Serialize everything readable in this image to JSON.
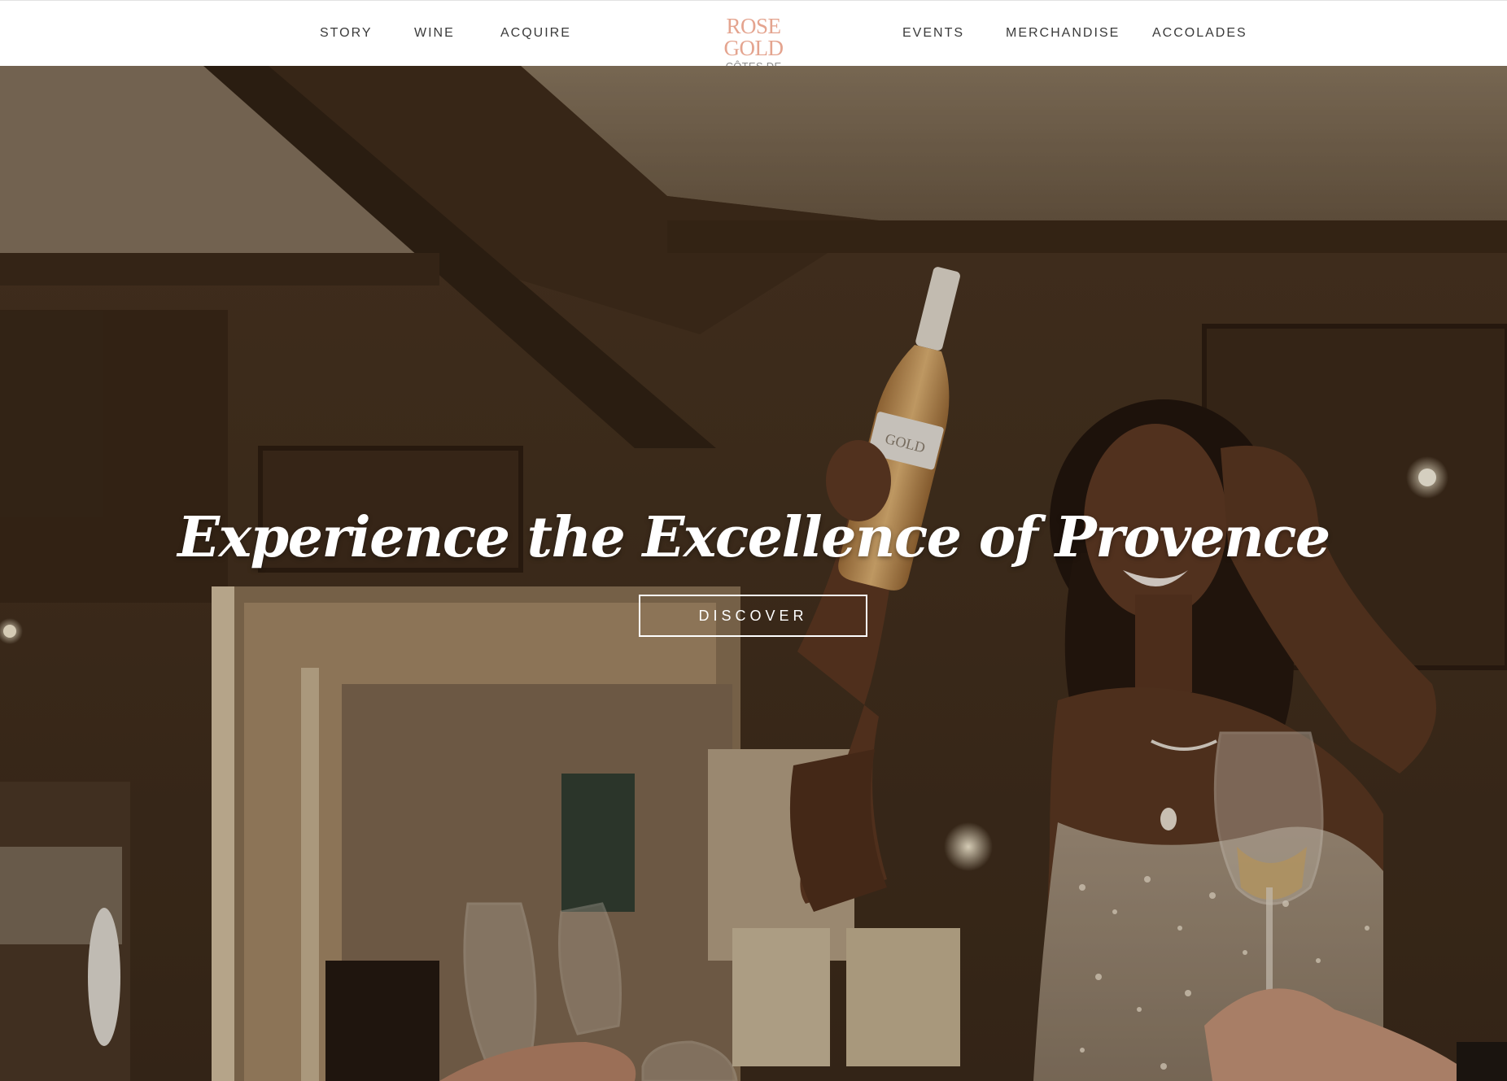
{
  "header": {
    "nav_left": [
      {
        "label": "STORY"
      },
      {
        "label": "WINE"
      },
      {
        "label": "ACQUIRE"
      }
    ],
    "logo": {
      "title": "ROSE GOLD",
      "subtitle": "CÔTES DE PROVENCE"
    },
    "nav_right": [
      {
        "label": "EVENTS"
      },
      {
        "label": "MERCHANDISE"
      },
      {
        "label": "ACCOLADES"
      }
    ]
  },
  "hero": {
    "headline": "Experience the Excellence of Provence",
    "cta_label": "DISCOVER",
    "bottle_label": "GOLD"
  },
  "colors": {
    "logo_accent": "#e4a48f",
    "nav_text": "#3a3a3a",
    "hero_text": "#ffffff"
  }
}
